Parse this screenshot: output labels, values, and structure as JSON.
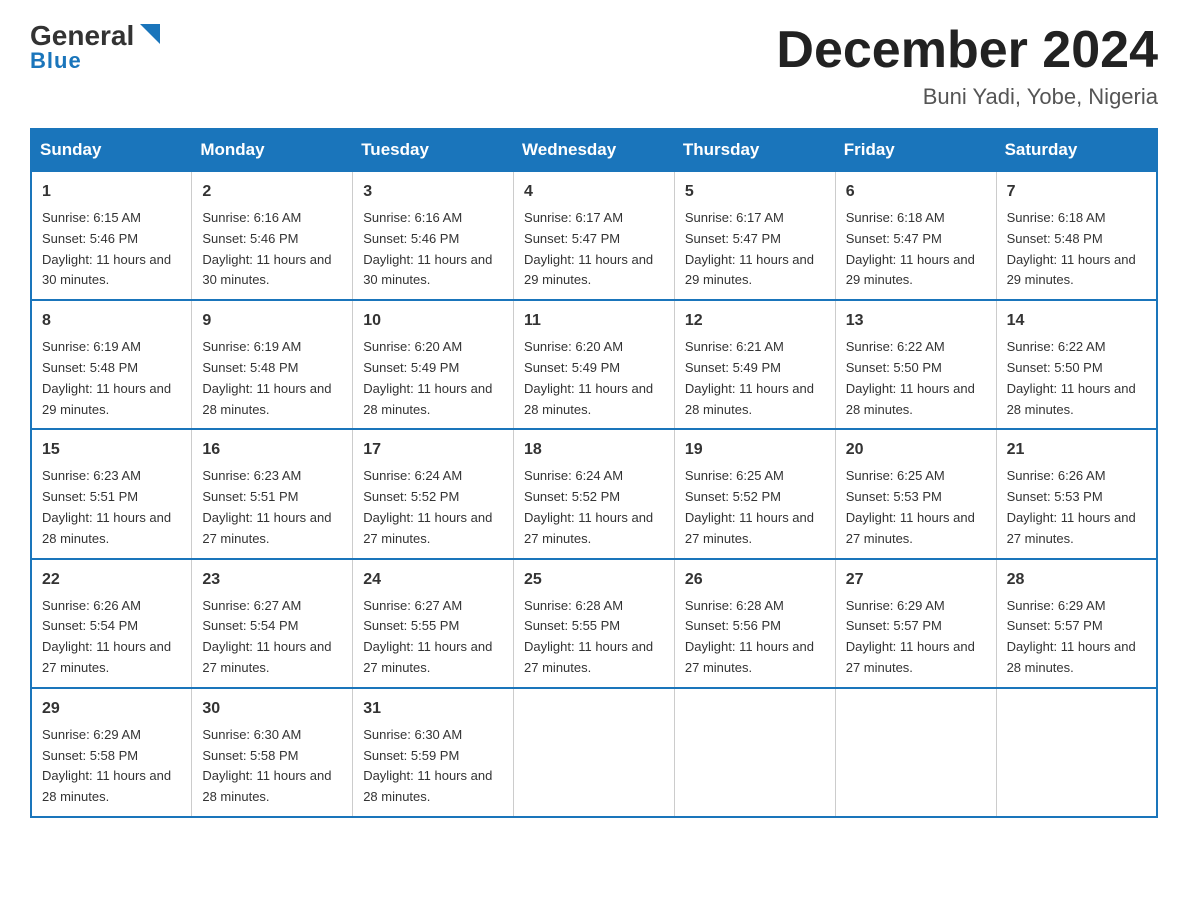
{
  "logo": {
    "general": "General",
    "blue": "Blue"
  },
  "header": {
    "month_year": "December 2024",
    "location": "Buni Yadi, Yobe, Nigeria"
  },
  "days_of_week": [
    "Sunday",
    "Monday",
    "Tuesday",
    "Wednesday",
    "Thursday",
    "Friday",
    "Saturday"
  ],
  "weeks": [
    [
      {
        "day": "1",
        "sunrise": "Sunrise: 6:15 AM",
        "sunset": "Sunset: 5:46 PM",
        "daylight": "Daylight: 11 hours and 30 minutes."
      },
      {
        "day": "2",
        "sunrise": "Sunrise: 6:16 AM",
        "sunset": "Sunset: 5:46 PM",
        "daylight": "Daylight: 11 hours and 30 minutes."
      },
      {
        "day": "3",
        "sunrise": "Sunrise: 6:16 AM",
        "sunset": "Sunset: 5:46 PM",
        "daylight": "Daylight: 11 hours and 30 minutes."
      },
      {
        "day": "4",
        "sunrise": "Sunrise: 6:17 AM",
        "sunset": "Sunset: 5:47 PM",
        "daylight": "Daylight: 11 hours and 29 minutes."
      },
      {
        "day": "5",
        "sunrise": "Sunrise: 6:17 AM",
        "sunset": "Sunset: 5:47 PM",
        "daylight": "Daylight: 11 hours and 29 minutes."
      },
      {
        "day": "6",
        "sunrise": "Sunrise: 6:18 AM",
        "sunset": "Sunset: 5:47 PM",
        "daylight": "Daylight: 11 hours and 29 minutes."
      },
      {
        "day": "7",
        "sunrise": "Sunrise: 6:18 AM",
        "sunset": "Sunset: 5:48 PM",
        "daylight": "Daylight: 11 hours and 29 minutes."
      }
    ],
    [
      {
        "day": "8",
        "sunrise": "Sunrise: 6:19 AM",
        "sunset": "Sunset: 5:48 PM",
        "daylight": "Daylight: 11 hours and 29 minutes."
      },
      {
        "day": "9",
        "sunrise": "Sunrise: 6:19 AM",
        "sunset": "Sunset: 5:48 PM",
        "daylight": "Daylight: 11 hours and 28 minutes."
      },
      {
        "day": "10",
        "sunrise": "Sunrise: 6:20 AM",
        "sunset": "Sunset: 5:49 PM",
        "daylight": "Daylight: 11 hours and 28 minutes."
      },
      {
        "day": "11",
        "sunrise": "Sunrise: 6:20 AM",
        "sunset": "Sunset: 5:49 PM",
        "daylight": "Daylight: 11 hours and 28 minutes."
      },
      {
        "day": "12",
        "sunrise": "Sunrise: 6:21 AM",
        "sunset": "Sunset: 5:49 PM",
        "daylight": "Daylight: 11 hours and 28 minutes."
      },
      {
        "day": "13",
        "sunrise": "Sunrise: 6:22 AM",
        "sunset": "Sunset: 5:50 PM",
        "daylight": "Daylight: 11 hours and 28 minutes."
      },
      {
        "day": "14",
        "sunrise": "Sunrise: 6:22 AM",
        "sunset": "Sunset: 5:50 PM",
        "daylight": "Daylight: 11 hours and 28 minutes."
      }
    ],
    [
      {
        "day": "15",
        "sunrise": "Sunrise: 6:23 AM",
        "sunset": "Sunset: 5:51 PM",
        "daylight": "Daylight: 11 hours and 28 minutes."
      },
      {
        "day": "16",
        "sunrise": "Sunrise: 6:23 AM",
        "sunset": "Sunset: 5:51 PM",
        "daylight": "Daylight: 11 hours and 27 minutes."
      },
      {
        "day": "17",
        "sunrise": "Sunrise: 6:24 AM",
        "sunset": "Sunset: 5:52 PM",
        "daylight": "Daylight: 11 hours and 27 minutes."
      },
      {
        "day": "18",
        "sunrise": "Sunrise: 6:24 AM",
        "sunset": "Sunset: 5:52 PM",
        "daylight": "Daylight: 11 hours and 27 minutes."
      },
      {
        "day": "19",
        "sunrise": "Sunrise: 6:25 AM",
        "sunset": "Sunset: 5:52 PM",
        "daylight": "Daylight: 11 hours and 27 minutes."
      },
      {
        "day": "20",
        "sunrise": "Sunrise: 6:25 AM",
        "sunset": "Sunset: 5:53 PM",
        "daylight": "Daylight: 11 hours and 27 minutes."
      },
      {
        "day": "21",
        "sunrise": "Sunrise: 6:26 AM",
        "sunset": "Sunset: 5:53 PM",
        "daylight": "Daylight: 11 hours and 27 minutes."
      }
    ],
    [
      {
        "day": "22",
        "sunrise": "Sunrise: 6:26 AM",
        "sunset": "Sunset: 5:54 PM",
        "daylight": "Daylight: 11 hours and 27 minutes."
      },
      {
        "day": "23",
        "sunrise": "Sunrise: 6:27 AM",
        "sunset": "Sunset: 5:54 PM",
        "daylight": "Daylight: 11 hours and 27 minutes."
      },
      {
        "day": "24",
        "sunrise": "Sunrise: 6:27 AM",
        "sunset": "Sunset: 5:55 PM",
        "daylight": "Daylight: 11 hours and 27 minutes."
      },
      {
        "day": "25",
        "sunrise": "Sunrise: 6:28 AM",
        "sunset": "Sunset: 5:55 PM",
        "daylight": "Daylight: 11 hours and 27 minutes."
      },
      {
        "day": "26",
        "sunrise": "Sunrise: 6:28 AM",
        "sunset": "Sunset: 5:56 PM",
        "daylight": "Daylight: 11 hours and 27 minutes."
      },
      {
        "day": "27",
        "sunrise": "Sunrise: 6:29 AM",
        "sunset": "Sunset: 5:57 PM",
        "daylight": "Daylight: 11 hours and 27 minutes."
      },
      {
        "day": "28",
        "sunrise": "Sunrise: 6:29 AM",
        "sunset": "Sunset: 5:57 PM",
        "daylight": "Daylight: 11 hours and 28 minutes."
      }
    ],
    [
      {
        "day": "29",
        "sunrise": "Sunrise: 6:29 AM",
        "sunset": "Sunset: 5:58 PM",
        "daylight": "Daylight: 11 hours and 28 minutes."
      },
      {
        "day": "30",
        "sunrise": "Sunrise: 6:30 AM",
        "sunset": "Sunset: 5:58 PM",
        "daylight": "Daylight: 11 hours and 28 minutes."
      },
      {
        "day": "31",
        "sunrise": "Sunrise: 6:30 AM",
        "sunset": "Sunset: 5:59 PM",
        "daylight": "Daylight: 11 hours and 28 minutes."
      },
      {
        "day": "",
        "sunrise": "",
        "sunset": "",
        "daylight": ""
      },
      {
        "day": "",
        "sunrise": "",
        "sunset": "",
        "daylight": ""
      },
      {
        "day": "",
        "sunrise": "",
        "sunset": "",
        "daylight": ""
      },
      {
        "day": "",
        "sunrise": "",
        "sunset": "",
        "daylight": ""
      }
    ]
  ]
}
